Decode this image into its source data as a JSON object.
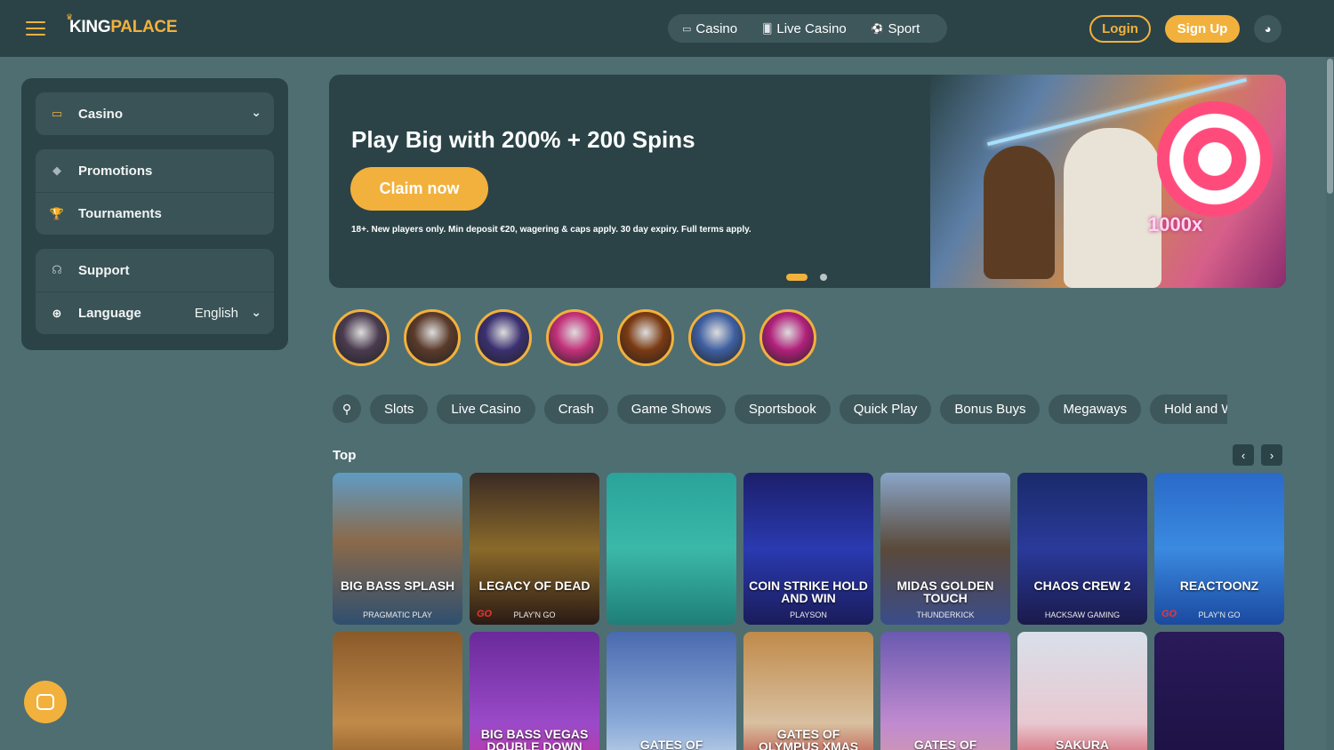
{
  "header": {
    "logo_king": "KING",
    "logo_palace": "PALACE",
    "nav": [
      {
        "icon": "slot-icon",
        "glyph": "▭",
        "label": "Casino"
      },
      {
        "icon": "cards-icon",
        "glyph": "🂠",
        "label": "Live Casino"
      },
      {
        "icon": "soccer-ball-icon",
        "glyph": "⚽",
        "label": "Sport"
      }
    ],
    "login_label": "Login",
    "signup_label": "Sign Up"
  },
  "sidebar": {
    "casino_label": "Casino",
    "promotions_label": "Promotions",
    "tournaments_label": "Tournaments",
    "support_label": "Support",
    "language_label": "Language",
    "language_value": "English"
  },
  "hero": {
    "title": "Play Big with 200% + 200 Spins",
    "cta_label": "Claim now",
    "terms": "18+. New players only. Min deposit €20, wagering & caps apply. 30 day expiry. Full terms apply.",
    "multiplier": "1000x",
    "slides": 2,
    "active_slide": 1
  },
  "stories": [
    {
      "color": "#4a3b4f"
    },
    {
      "color": "#5a3a2a"
    },
    {
      "color": "#3a3070"
    },
    {
      "color": "#c2307a"
    },
    {
      "color": "#7a3a12"
    },
    {
      "color": "#3e5fa0"
    },
    {
      "color": "#b0207a"
    }
  ],
  "categories": [
    "Slots",
    "Live Casino",
    "Crash",
    "Game Shows",
    "Sportsbook",
    "Quick Play",
    "Bonus Buys",
    "Megaways",
    "Hold and Win"
  ],
  "top_section": {
    "title": "Top",
    "prev_label": "‹",
    "next_label": "›"
  },
  "games": [
    {
      "name": "BIG BASS SPLASH",
      "provider": "PRAGMATIC PLAY",
      "logo": "",
      "bg": "linear-gradient(180deg,#5f9cc4 0%,#8a6a4a 45%,#2f4f6f 100%)"
    },
    {
      "name": "LEGACY OF DEAD",
      "provider": "PLAY'N GO",
      "logo": "GO",
      "bg": "linear-gradient(180deg,#3a2a24 0%,#8a6a2a 50%,#2a1a14 100%)"
    },
    {
      "name": "",
      "provider": "",
      "logo": "",
      "bg": "linear-gradient(180deg,#2aa39a 0%,#3bb8a8 50%,#1f7f78 100%)"
    },
    {
      "name": "COIN STRIKE HOLD AND WIN",
      "provider": "PLAYSON",
      "logo": "",
      "bg": "linear-gradient(180deg,#1c1f6a 0%,#2a3ab0 50%,#1a1c5a 100%)"
    },
    {
      "name": "MIDAS GOLDEN TOUCH",
      "provider": "THUNDERKICK",
      "logo": "",
      "bg": "linear-gradient(180deg,#8aa5c8 0%,#5a4a3a 50%,#3a4c8a 100%)"
    },
    {
      "name": "CHAOS CREW 2",
      "provider": "HACKSAW GAMING",
      "logo": "",
      "bg": "linear-gradient(180deg,#1a2a6a 0%,#2a3a9a 50%,#1a1a4a 100%)"
    },
    {
      "name": "REACTOONZ",
      "provider": "PLAY'N GO",
      "logo": "GO",
      "bg": "linear-gradient(180deg,#2a6ac8 0%,#3a8ae0 50%,#1a4aa0 100%)"
    },
    {
      "name": "",
      "provider": "",
      "logo": "",
      "bg": "linear-gradient(180deg,#8a5a2a 0%,#c08a4a 60%,#7a4a1a 100%)"
    },
    {
      "name": "BIG BASS VEGAS DOUBLE DOWN",
      "provider": "",
      "logo": "",
      "bg": "linear-gradient(180deg,#6a2a9a 0%,#9a4ac8 60%,#d0309a 100%)"
    },
    {
      "name": "GATES OF",
      "provider": "",
      "logo": "",
      "bg": "linear-gradient(180deg,#4a6ab0 0%,#8aaad8 60%,#d8e4f0 100%)"
    },
    {
      "name": "GATES OF OLYMPUS XMAS",
      "provider": "",
      "logo": "",
      "bg": "linear-gradient(180deg,#c08a4a 0%,#d8c0a0 60%,#b02020 100%)"
    },
    {
      "name": "GATES OF",
      "provider": "",
      "logo": "",
      "bg": "linear-gradient(180deg,#6a5ab0 0%,#c08ad0 60%,#d8a0a0 100%)"
    },
    {
      "name": "SAKURA",
      "provider": "",
      "logo": "",
      "bg": "linear-gradient(180deg,#d8e0ea 0%,#e8c8d0 60%,#c83040 100%)"
    },
    {
      "name": "",
      "provider": "",
      "logo": "",
      "bg": "linear-gradient(180deg,#2a1a5a 0%,#1a1040 100%)"
    }
  ]
}
